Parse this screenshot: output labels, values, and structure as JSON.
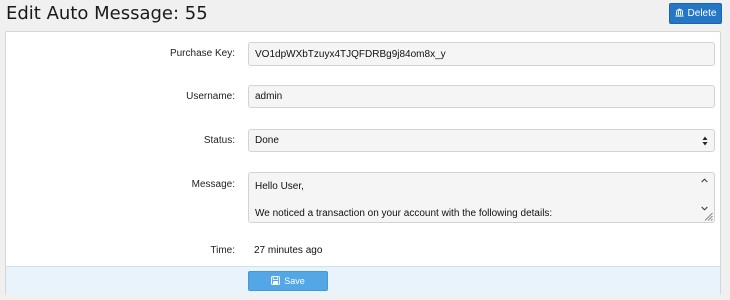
{
  "header": {
    "title": "Edit Auto Message: 55",
    "delete_label": "Delete"
  },
  "form": {
    "purchase_key": {
      "label": "Purchase Key:",
      "value": "VO1dpWXbTzuyx4TJQFDRBg9j84om8x_y"
    },
    "username": {
      "label": "Username:",
      "value": "admin"
    },
    "status": {
      "label": "Status:",
      "value": "Done"
    },
    "message": {
      "label": "Message:",
      "line1": "Hello User,",
      "line2": "We noticed a transaction on your account with the following details:"
    },
    "time": {
      "label": "Time:",
      "value": "27 minutes ago"
    }
  },
  "footer": {
    "save_label": "Save"
  },
  "icons": {
    "delete": "bank-icon",
    "save": "floppy-disk-icon",
    "select": "sort-arrows-icon"
  },
  "colors": {
    "delete_button": "#2577c5",
    "save_button": "#53a7e6",
    "footer_bg": "#e8f3fb"
  }
}
